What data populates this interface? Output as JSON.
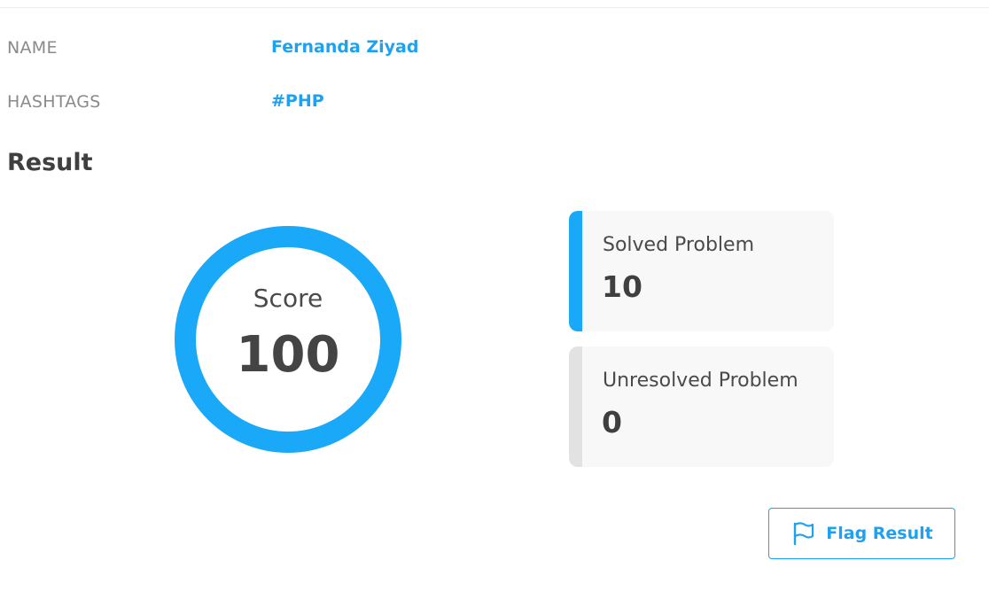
{
  "info": {
    "name_label": "NAME",
    "name_value": "Fernanda Ziyad",
    "hashtags_label": "HASHTAGS",
    "hashtags_value": "#PHP"
  },
  "result": {
    "title": "Result",
    "score_label": "Score",
    "score_value": "100",
    "score_percent": 100
  },
  "stats": [
    {
      "title": "Solved Problem",
      "value": "10",
      "accent": "#1aa9f8"
    },
    {
      "title": "Unresolved Problem",
      "value": "0",
      "accent": "#e2e2e2"
    }
  ],
  "actions": {
    "flag_label": "Flag Result",
    "flag_icon": "flag-icon"
  },
  "colors": {
    "accent": "#1ea1ef",
    "ring": "#1aa9f8"
  }
}
